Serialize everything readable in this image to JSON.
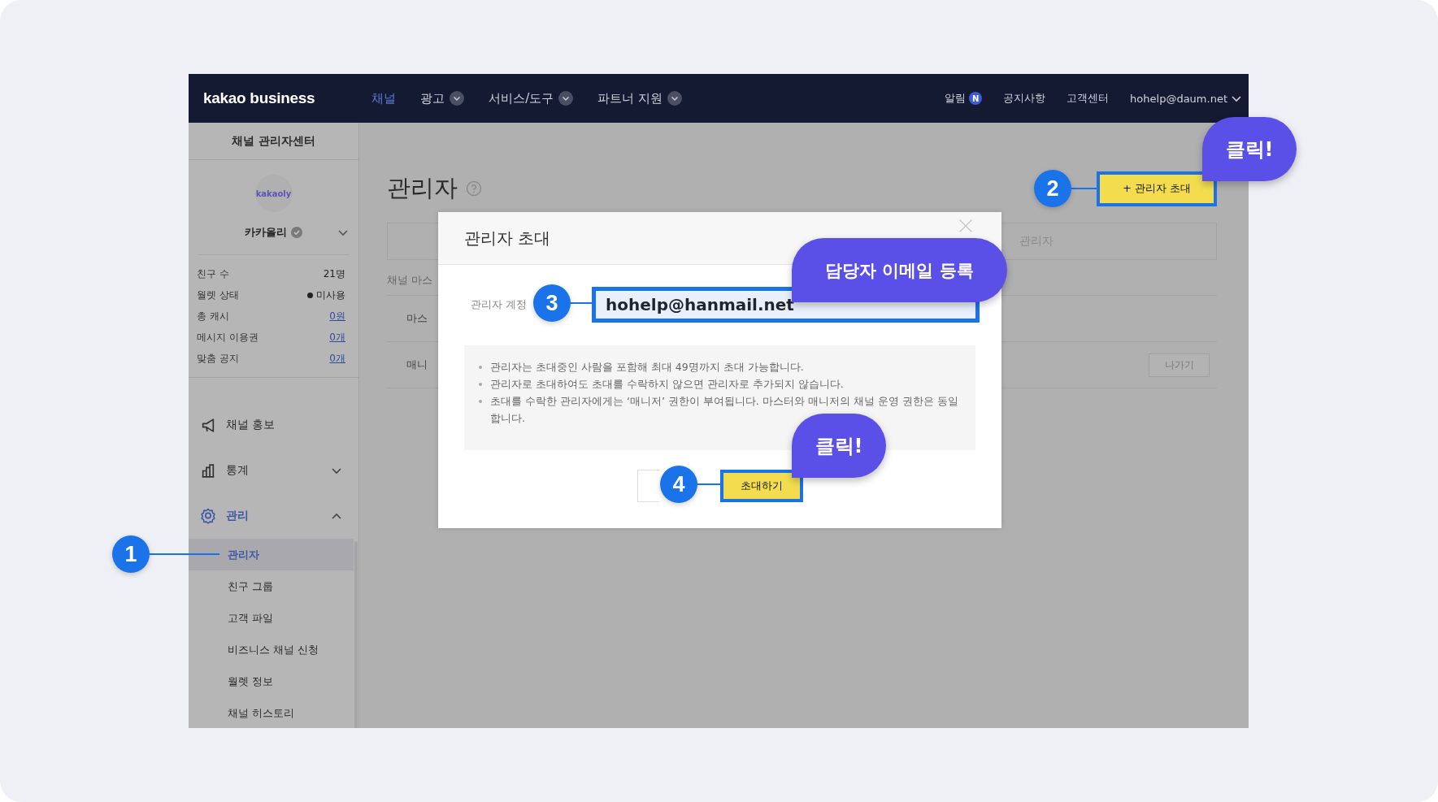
{
  "nav": {
    "logo": "kakao business",
    "items": [
      {
        "label": "채널",
        "selected": true,
        "dropdown": false
      },
      {
        "label": "광고",
        "selected": false,
        "dropdown": true
      },
      {
        "label": "서비스/도구",
        "selected": false,
        "dropdown": true
      },
      {
        "label": "파트너 지원",
        "selected": false,
        "dropdown": true
      }
    ],
    "links": [
      {
        "label": "알림",
        "badge": "N",
        "dropdown": false
      },
      {
        "label": "공지사항",
        "dropdown": false
      },
      {
        "label": "고객센터",
        "dropdown": false
      },
      {
        "label": "hohelp@daum.net",
        "dropdown": true
      }
    ]
  },
  "sidebar": {
    "title": "채널 관리자센터",
    "channel": {
      "logo": "kakaoly",
      "name": "카카올리",
      "verified": true
    },
    "stats": [
      {
        "label": "친구 수",
        "value": "21명",
        "kind": "plain"
      },
      {
        "label": "월렛 상태",
        "value": "미사용",
        "kind": "status"
      },
      {
        "label": "총 캐시",
        "value": "0원",
        "kind": "link"
      },
      {
        "label": "메시지 이용권",
        "value": "0개",
        "kind": "link"
      },
      {
        "label": "맞춤 공지",
        "value": "0개",
        "kind": "link"
      }
    ],
    "menu": [
      {
        "label": "채널 홍보",
        "selected": false
      },
      {
        "label": "통계",
        "selected": false,
        "expanded": false
      },
      {
        "label": "관리",
        "selected": true,
        "expanded": true,
        "children": [
          {
            "label": "관리자",
            "selected": true
          },
          {
            "label": "친구 그룹",
            "selected": false
          },
          {
            "label": "고객 파일",
            "selected": false
          },
          {
            "label": "비즈니스 채널 신청",
            "selected": false
          },
          {
            "label": "월렛 정보",
            "selected": false
          },
          {
            "label": "채널 히스토리",
            "selected": false
          }
        ]
      }
    ]
  },
  "page": {
    "title": "관리자",
    "invite_button": "+ 관리자 초대",
    "filter_text": "관리자",
    "section_label": "채널 마스",
    "rows": [
      {
        "label": "마스"
      },
      {
        "label": "매니",
        "action": "나가기"
      }
    ]
  },
  "dialog": {
    "title": "관리자 초대",
    "field_label": "관리자 계정",
    "value": "hohelp@hanmail.net",
    "notes": [
      "관리자는 초대중인 사람을 포함해 최대 49명까지 초대 가능합니다.",
      "관리자로 초대하여도 초대를 수락하지 않으면 관리자로 추가되지 않습니다.",
      "초대를 수락한 관리자에게는 ‘매니저’ 권한이 부여됩니다. 마스터와 매니저의 채널 운영 권한은 동일합니다."
    ],
    "buttons": [
      {
        "kind": "secondary"
      },
      {
        "kind": "primary",
        "label": "초대하기"
      }
    ]
  },
  "annotations": {
    "steps": [
      {
        "number": "1"
      },
      {
        "number": "2"
      },
      {
        "number": "3"
      },
      {
        "number": "4"
      }
    ],
    "bubbles": [
      {
        "text": "클릭!"
      },
      {
        "text": "담당자 이메일 등록"
      },
      {
        "text": "클릭!"
      }
    ]
  }
}
